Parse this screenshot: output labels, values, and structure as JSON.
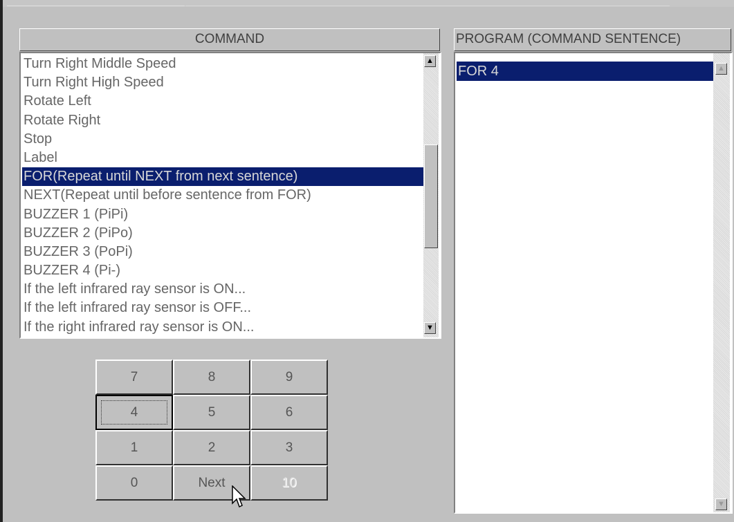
{
  "command_panel": {
    "header": "COMMAND",
    "items": [
      "Turn Right Middle Speed",
      "Turn Right High Speed",
      "Rotate Left",
      "Rotate Right",
      "Stop",
      "Label",
      "FOR(Repeat until NEXT from next sentence)",
      "NEXT(Repeat until before sentence from FOR)",
      "BUZZER 1 (PiPi)",
      "BUZZER 2 (PiPo)",
      "BUZZER 3 (PoPi)",
      "BUZZER 4 (Pi-)",
      "If the left infrared ray sensor is ON...",
      "If the left infrared ray sensor is OFF...",
      "If the right infrared ray sensor is ON..."
    ],
    "selected_index": 6,
    "scroll_up_icon": "arrow-up-icon",
    "scroll_down_icon": "arrow-down-icon"
  },
  "program_panel": {
    "header": "PROGRAM (COMMAND SENTENCE)",
    "items": [
      "FOR  4"
    ]
  },
  "keypad": {
    "keys": [
      "7",
      "8",
      "9",
      "4",
      "5",
      "6",
      "1",
      "2",
      "3",
      "0",
      "Next",
      "10"
    ],
    "focused_key": "4",
    "disabled_key": "10"
  },
  "colors": {
    "selection": "#0a1e6e",
    "face": "#c0c0c0"
  }
}
